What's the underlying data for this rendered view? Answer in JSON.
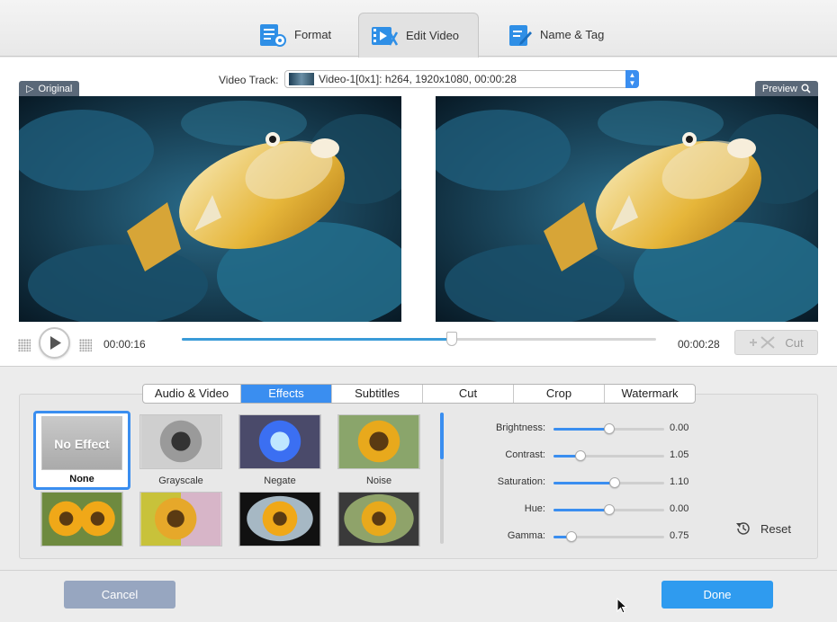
{
  "toolbar": {
    "tabs": [
      {
        "label": "Format",
        "icon": "format-settings-icon"
      },
      {
        "label": "Edit Video",
        "icon": "film-edit-icon",
        "active": true
      },
      {
        "label": "Name & Tag",
        "icon": "tag-edit-icon"
      }
    ]
  },
  "video_track": {
    "label": "Video Track:",
    "value": "Video-1[0x1]: h264, 1920x1080, 00:00:28"
  },
  "panes": {
    "original_label": "Original",
    "preview_label": "Preview"
  },
  "playback": {
    "current_time": "00:00:16",
    "total_time": "00:00:28",
    "progress": 0.57,
    "cut_label": "Cut"
  },
  "edit_tabs": [
    {
      "label": "Audio & Video"
    },
    {
      "label": "Effects",
      "active": true
    },
    {
      "label": "Subtitles"
    },
    {
      "label": "Cut"
    },
    {
      "label": "Crop"
    },
    {
      "label": "Watermark"
    }
  ],
  "effects": {
    "selected_thumb_text": "No Effect",
    "items": [
      {
        "label": "None"
      },
      {
        "label": "Grayscale"
      },
      {
        "label": "Negate"
      },
      {
        "label": "Noise"
      },
      {
        "label": ""
      },
      {
        "label": ""
      },
      {
        "label": ""
      },
      {
        "label": ""
      }
    ]
  },
  "adjustments": [
    {
      "label": "Brightness:",
      "value": "0.00",
      "level": 0.5
    },
    {
      "label": "Contrast:",
      "value": "1.05",
      "level": 0.24
    },
    {
      "label": "Saturation:",
      "value": "1.10",
      "level": 0.55
    },
    {
      "label": "Hue:",
      "value": "0.00",
      "level": 0.5
    },
    {
      "label": "Gamma:",
      "value": "0.75",
      "level": 0.16
    }
  ],
  "reset_label": "Reset",
  "footer": {
    "cancel_label": "Cancel",
    "done_label": "Done"
  },
  "colors": {
    "accent": "#3a8ef0",
    "done": "#2f9bef",
    "cancel": "#97a6c0",
    "pane_label": "#5a6878"
  }
}
